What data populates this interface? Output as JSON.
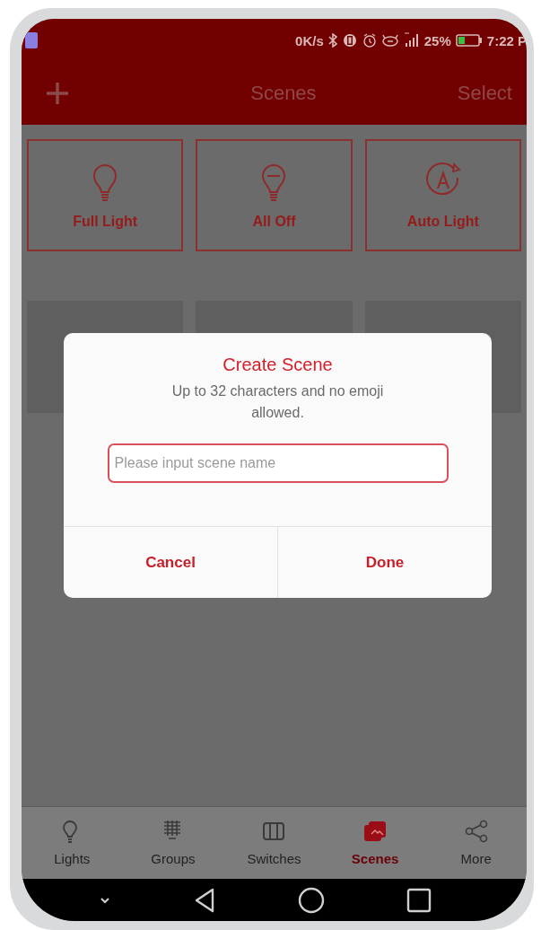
{
  "status_bar": {
    "speed": "0K/s",
    "battery": "25%",
    "time": "7:22 P"
  },
  "header": {
    "title": "Scenes",
    "action": "Select"
  },
  "scene_cards": [
    {
      "label": "Full Light",
      "kind": "bulb"
    },
    {
      "label": "All Off",
      "kind": "bulb-off"
    },
    {
      "label": "Auto Light",
      "kind": "auto"
    }
  ],
  "dialog": {
    "title": "Create Scene",
    "message": "Up to 32 characters and no emoji allowed.",
    "input": {
      "placeholder": "Please input scene name"
    },
    "buttons": [
      "Cancel",
      "Done"
    ]
  },
  "tabs": [
    {
      "label": "Lights",
      "kind": "bulb",
      "selected": false
    },
    {
      "label": "Groups",
      "kind": "groups",
      "selected": false
    },
    {
      "label": "Switches",
      "kind": "switch",
      "selected": false
    },
    {
      "label": "Scenes",
      "kind": "scene",
      "selected": true
    },
    {
      "label": "More",
      "kind": "share",
      "selected": false
    }
  ]
}
